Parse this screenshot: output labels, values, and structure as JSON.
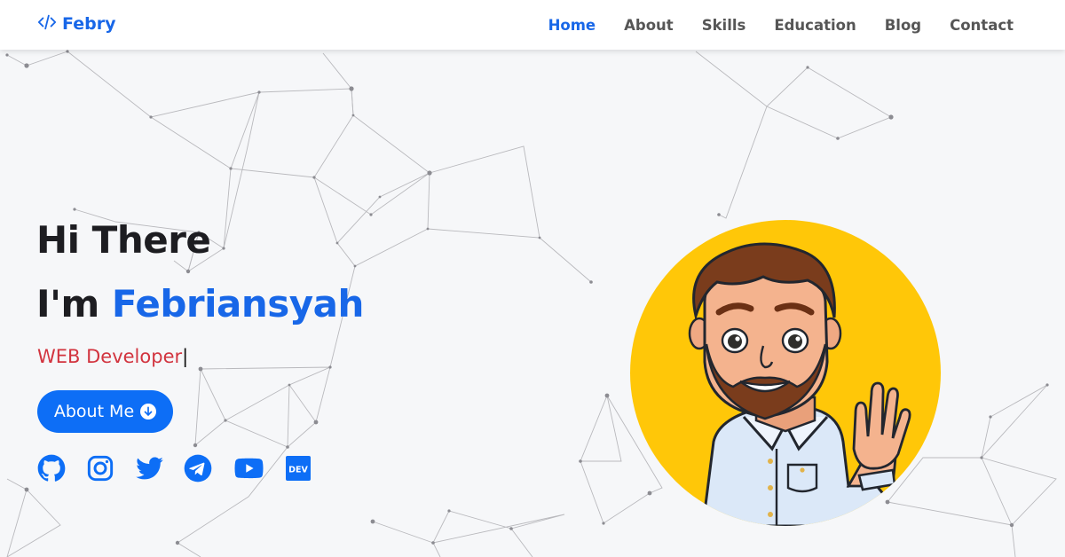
{
  "nav": {
    "brand_name": "Febry",
    "items": [
      {
        "label": "Home",
        "active": true
      },
      {
        "label": "About",
        "active": false
      },
      {
        "label": "Skills",
        "active": false
      },
      {
        "label": "Education",
        "active": false
      },
      {
        "label": "Blog",
        "active": false
      },
      {
        "label": "Contact",
        "active": false
      }
    ]
  },
  "hero": {
    "greeting": "Hi There",
    "intro": "I'm",
    "name": "Febriansyah",
    "typed_text": "WEB Developer",
    "cursor": "|",
    "button_label": "About Me"
  },
  "socials": [
    {
      "icon": "github-icon"
    },
    {
      "icon": "instagram-icon"
    },
    {
      "icon": "twitter-icon"
    },
    {
      "icon": "telegram-icon"
    },
    {
      "icon": "youtube-icon"
    },
    {
      "icon": "dev-icon",
      "label": "DEV"
    }
  ],
  "colors": {
    "accent": "#1867e8",
    "button": "#0d6ef6",
    "typed": "#d2343f",
    "avatar_bg": "#ffc708",
    "background": "#f6f7f9"
  }
}
